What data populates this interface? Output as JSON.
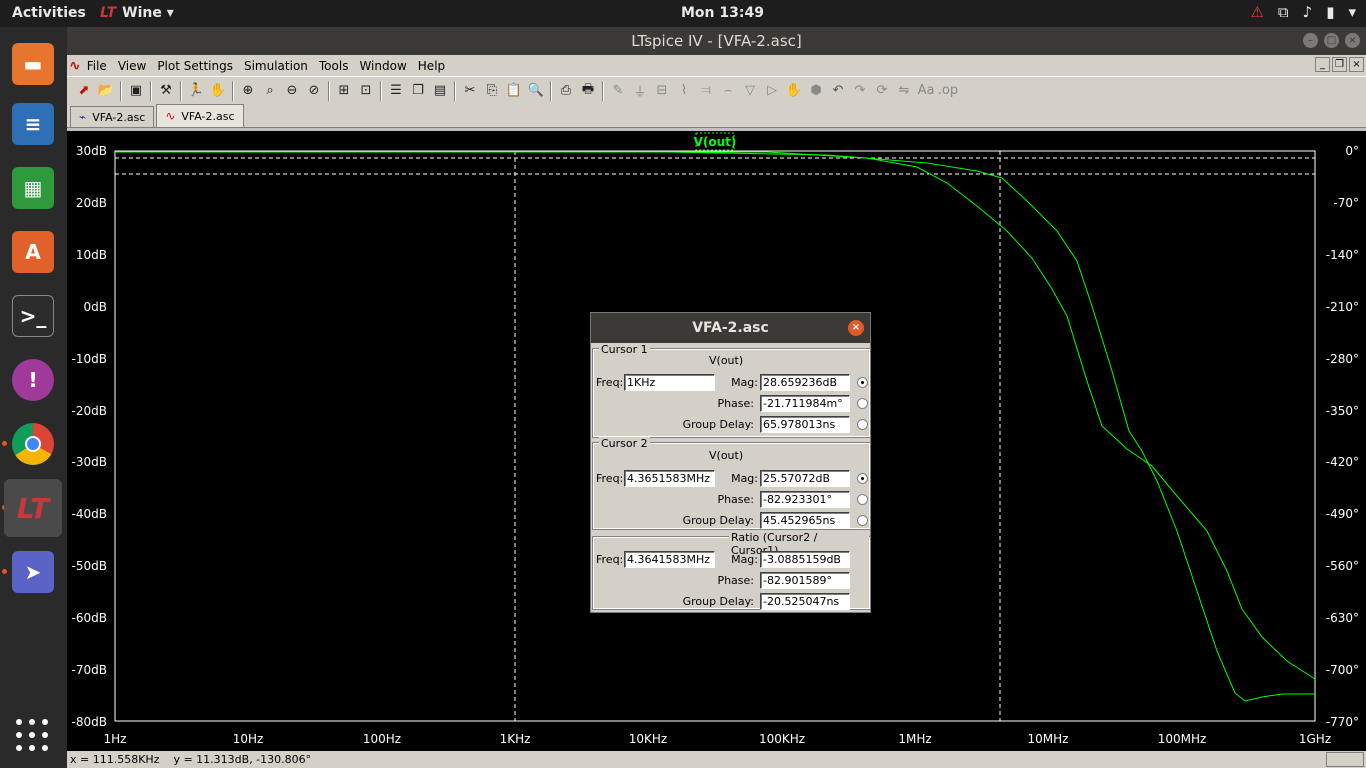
{
  "topbar": {
    "activities": "Activities",
    "app_name": "Wine",
    "clock": "Mon 13:49"
  },
  "window": {
    "title": "LTspice IV - [VFA-2.asc]"
  },
  "menu": [
    "File",
    "View",
    "Plot Settings",
    "Simulation",
    "Tools",
    "Window",
    "Help"
  ],
  "tabs": [
    {
      "label": "VFA-2.asc",
      "icon": "schematic-icon"
    },
    {
      "label": "VFA-2.asc",
      "icon": "waveform-icon"
    }
  ],
  "plot": {
    "trace_label": "V(out)",
    "trace_color": "#00ff00",
    "left_axis_ticks": [
      "30dB",
      "20dB",
      "10dB",
      "0dB",
      "-10dB",
      "-20dB",
      "-30dB",
      "-40dB",
      "-50dB",
      "-60dB",
      "-70dB",
      "-80dB"
    ],
    "right_axis_ticks": [
      "0°",
      "-70°",
      "-140°",
      "-210°",
      "-280°",
      "-350°",
      "-420°",
      "-490°",
      "-560°",
      "-630°",
      "-700°",
      "-770°"
    ],
    "x_axis_ticks": [
      "1Hz",
      "10Hz",
      "100Hz",
      "1KHz",
      "10KHz",
      "100KHz",
      "1MHz",
      "10MHz",
      "100MHz",
      "1GHz"
    ]
  },
  "status": {
    "text": "x = 111.558KHz    y = 11.313dB, -130.806°"
  },
  "dialog": {
    "title": "VFA-2.asc",
    "cursor1": {
      "label": "Cursor 1",
      "trace": "V(out)",
      "freq_label": "Freq:",
      "freq": "1KHz",
      "mag_label": "Mag:",
      "mag": "28.659236dB",
      "phase_label": "Phase:",
      "phase": "-21.711984m°",
      "gd_label": "Group Delay:",
      "gd": "65.978013ns"
    },
    "cursor2": {
      "label": "Cursor 2",
      "trace": "V(out)",
      "freq_label": "Freq:",
      "freq": "4.3651583MHz",
      "mag_label": "Mag:",
      "mag": "25.57072dB",
      "phase_label": "Phase:",
      "phase": "-82.923301°",
      "gd_label": "Group Delay:",
      "gd": "45.452965ns"
    },
    "ratio": {
      "label": "Ratio (Cursor2 / Cursor1)",
      "freq_label": "Freq:",
      "freq": "4.3641583MHz",
      "mag_label": "Mag:",
      "mag": "-3.0885159dB",
      "phase_label": "Phase:",
      "phase": "-82.901589°",
      "gd_label": "Group Delay:",
      "gd": "-20.525047ns"
    }
  }
}
